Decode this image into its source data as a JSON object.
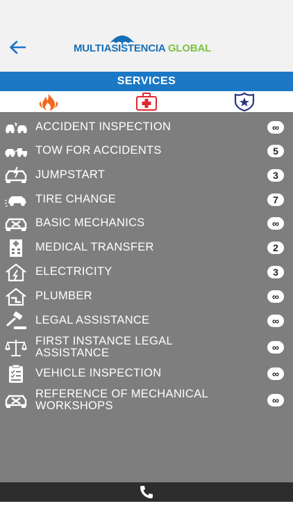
{
  "header": {
    "logo_part1": "MULTIASISTENCIA",
    "logo_part2": " GLOBAL",
    "back_icon": "arrow-left-icon"
  },
  "section_title": "SERVICES",
  "tabs": [
    {
      "icon": "fire-icon",
      "color": "#f2681d"
    },
    {
      "icon": "medical-kit-icon",
      "color": "#e1262d"
    },
    {
      "icon": "police-badge-icon",
      "color": "#27357e"
    }
  ],
  "services": [
    {
      "label": "ACCIDENT INSPECTION",
      "label2": "",
      "count": "∞",
      "icon": "car-crash-icon"
    },
    {
      "label": "TOW FOR ACCIDENTS",
      "label2": "",
      "count": "5",
      "icon": "tow-truck-icon"
    },
    {
      "label": "JUMPSTART",
      "label2": "",
      "count": "3",
      "icon": "car-battery-icon"
    },
    {
      "label": "TIRE CHANGE",
      "label2": "",
      "count": "7",
      "icon": "tire-change-icon"
    },
    {
      "label": "BASIC MECHANICS",
      "label2": "",
      "count": "∞",
      "icon": "car-wrench-icon"
    },
    {
      "label": "MEDICAL TRANSFER",
      "label2": "",
      "count": "2",
      "icon": "hospital-icon"
    },
    {
      "label": "ELECTRICITY",
      "label2": "",
      "count": "3",
      "icon": "house-electricity-icon"
    },
    {
      "label": "PLUMBER",
      "label2": "",
      "count": "∞",
      "icon": "house-plumbing-icon"
    },
    {
      "label": "LEGAL ASSISTANCE",
      "label2": "",
      "count": "∞",
      "icon": "gavel-icon"
    },
    {
      "label": "FIRST INSTANCE LEGAL",
      "label2": "ASSISTANCE",
      "count": "∞",
      "icon": "scales-icon"
    },
    {
      "label": "VEHICLE INSPECTION",
      "label2": "",
      "count": "∞",
      "icon": "clipboard-check-icon"
    },
    {
      "label": "REFERENCE OF MECHANICAL",
      "label2": "WORKSHOPS",
      "count": "∞",
      "icon": "car-wrench-icon"
    }
  ],
  "bottom_bar": {
    "icon": "phone-icon"
  },
  "colors": {
    "brand_blue": "#1570b7",
    "brand_green": "#7cc242",
    "header_blue": "#1b78c5",
    "list_gray": "#7e7e7e",
    "bottom_bar": "#2d2d2d"
  }
}
